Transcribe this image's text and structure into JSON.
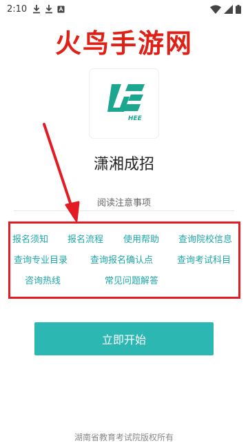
{
  "status_bar": {
    "time": "2:10",
    "icons": [
      "download-icon",
      "download-icon",
      "app-notification-icon",
      "wifi-icon",
      "signal-icon",
      "battery-icon"
    ]
  },
  "watermark": {
    "text": "火鸟手游网",
    "color": "#e02016"
  },
  "app": {
    "logo_text": "HEE",
    "name": "潇湘成招",
    "accent": "#2cb7b3"
  },
  "notice": {
    "title": "阅读注意事项",
    "links": [
      "报名须知",
      "报名流程",
      "使用帮助",
      "查询院校信息",
      "查询专业目录",
      "查询报名确认点",
      "查询考试科目",
      "咨询热线",
      "常见问题解答"
    ],
    "link_color": "#1fa7a8",
    "highlight_color": "#e31b23"
  },
  "start_button": {
    "label": "立即开始"
  },
  "footer": {
    "copyright": "湖南省教育考试院版权所有"
  }
}
